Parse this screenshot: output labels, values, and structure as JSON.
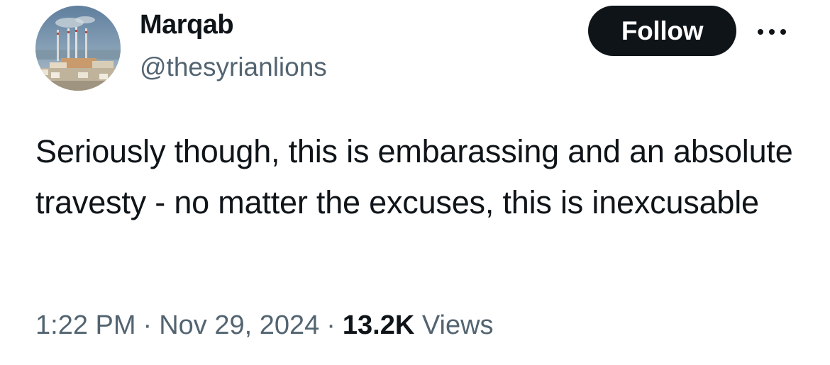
{
  "author": {
    "display_name": "Marqab",
    "handle": "@thesyrianlions",
    "avatar_icon": "industrial-skyline-avatar"
  },
  "actions": {
    "follow_label": "Follow",
    "more_icon": "more-horizontal-icon"
  },
  "tweet": {
    "text": "Seriously though, this is embarassing and an absolute travesty - no matter the excuses, this is inexcusable"
  },
  "meta": {
    "time": "1:22 PM",
    "separator": "·",
    "date": "Nov 29, 2024",
    "views_count": "13.2K",
    "views_label": "Views"
  },
  "colors": {
    "text_primary": "#0f1419",
    "text_secondary": "#536471",
    "follow_bg": "#0f1419",
    "follow_text": "#ffffff"
  }
}
